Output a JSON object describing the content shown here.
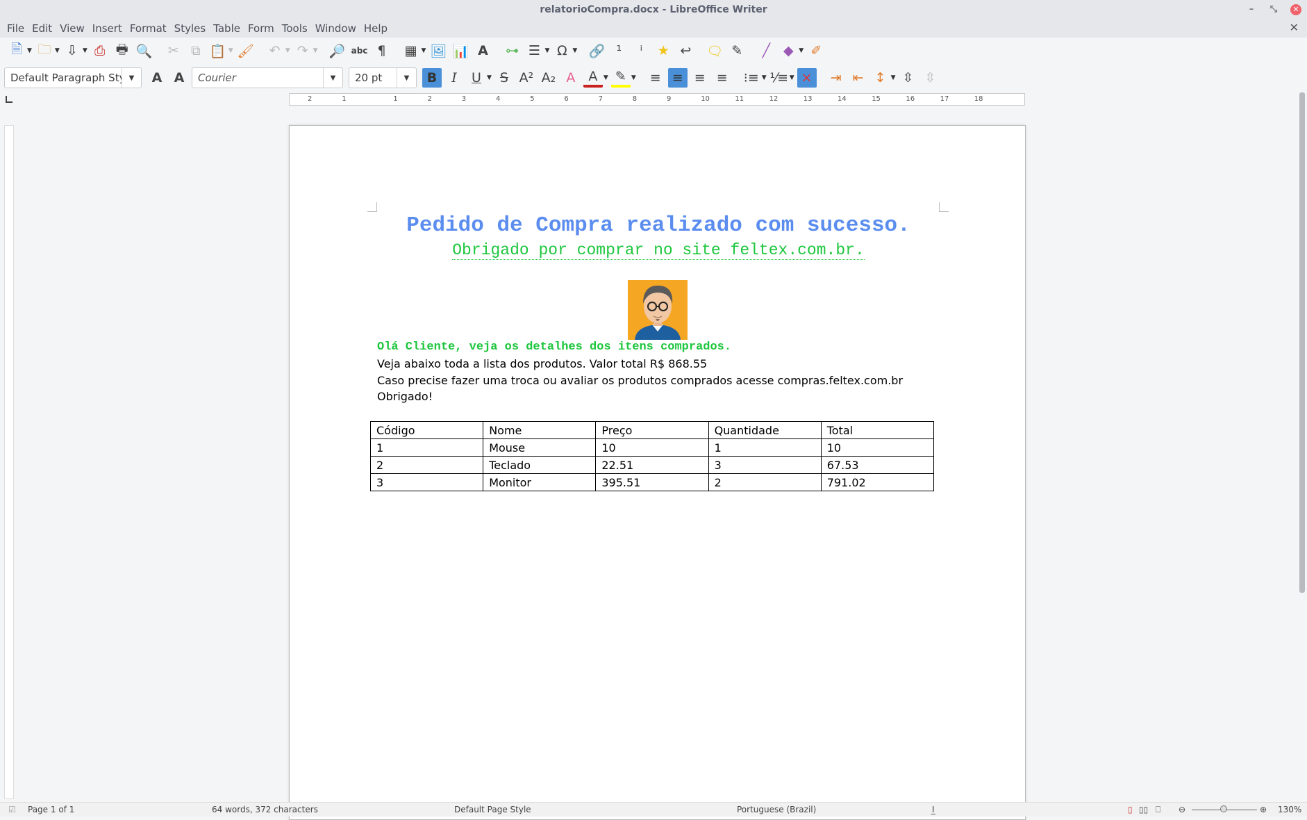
{
  "window": {
    "title": "relatorioCompra.docx - LibreOffice Writer"
  },
  "menubar": [
    "File",
    "Edit",
    "View",
    "Insert",
    "Format",
    "Styles",
    "Table",
    "Form",
    "Tools",
    "Window",
    "Help"
  ],
  "formatting": {
    "paragraph_style": "Default Paragraph Styl",
    "font_name": "Courier",
    "font_size": "20 pt",
    "bold_active": true,
    "align_center_active": true
  },
  "ruler": {
    "labels": [
      "2",
      "1",
      "1",
      "2",
      "3",
      "4",
      "5",
      "6",
      "7",
      "8",
      "9",
      "10",
      "11",
      "12",
      "13",
      "14",
      "15",
      "16",
      "17",
      "18"
    ]
  },
  "document": {
    "title": "Pedido de Compra realizado com sucesso.",
    "subtitle": "Obrigado por comprar no site feltex.com.br.",
    "greeting": "Olá Cliente, veja os detalhes dos itens comprados.",
    "line1": "Veja abaixo toda a lista dos produtos. Valor total R$ 868.55",
    "line2": "Caso precise fazer uma troca ou avaliar os produtos comprados acesse compras.feltex.com.br",
    "line3": "Obrigado!",
    "table": {
      "headers": [
        "Código",
        "Nome",
        "Preço",
        "Quantidade",
        "Total"
      ],
      "rows": [
        [
          "1",
          "Mouse",
          "10",
          "1",
          "10"
        ],
        [
          "2",
          "Teclado",
          "22.51",
          "3",
          "67.53"
        ],
        [
          "3",
          "Monitor",
          "395.51",
          "2",
          "791.02"
        ]
      ]
    }
  },
  "statusbar": {
    "page": "Page 1 of 1",
    "words": "64 words, 372 characters",
    "page_style": "Default Page Style",
    "language": "Portuguese (Brazil)",
    "insert_mode": "I̲",
    "zoom": "130%"
  },
  "colors": {
    "title": "#5b8def",
    "green": "#1dc63d",
    "accent": "#4a90d9"
  }
}
